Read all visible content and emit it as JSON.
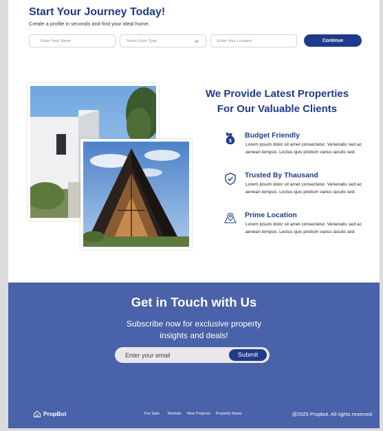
{
  "journey": {
    "title": "Start Your Journey Today!",
    "subtitle": "Create a profile in seconds and find your ideal home.",
    "name_placeholder": "Enter Your Name",
    "user_type_placeholder": "Select User Type",
    "location_placeholder": "Enter Your Location",
    "continue_label": "Continue"
  },
  "features": {
    "heading_line1": "We Provide Latest Properties",
    "heading_line2": "For Our Valuable Clients",
    "items": [
      {
        "title": "Budget Friendly",
        "icon": "money-bag-icon",
        "description": "Lorem ipsum dolor sit amet consectetur. Venenatis sed ac aenean tempus. Lectus quis pretium varius iaculis sed."
      },
      {
        "title": "Trusted By Thausand",
        "icon": "shield-check-icon",
        "description": "Lorem ipsum dolor sit amet consectetur. Venenatis sed ac aenean tempus. Lectus quis pretium varius iaculis sed."
      },
      {
        "title": "Prime Location",
        "icon": "map-pin-icon",
        "description": "Lorem ipsum dolor sit amet consectetur. Venenatis sed ac aenean tempus. Lectus quis pretium varius iaculis sed."
      }
    ]
  },
  "contact": {
    "title": "Get in Touch with Us",
    "subtitle": "Subscribe now for exclusive property insights and deals!",
    "email_placeholder": "Enter your email",
    "submit_label": "Submit"
  },
  "footer": {
    "brand": "PropBot",
    "links": [
      "For Sale",
      "Rentals",
      "New Projects",
      "Property News"
    ],
    "copyright": "@2025 Propbot. All rights reserved"
  },
  "colors": {
    "brand_navy": "#1f3a8a",
    "contact_bg": "#4a62a9",
    "page_bg": "#dcdcdc"
  }
}
